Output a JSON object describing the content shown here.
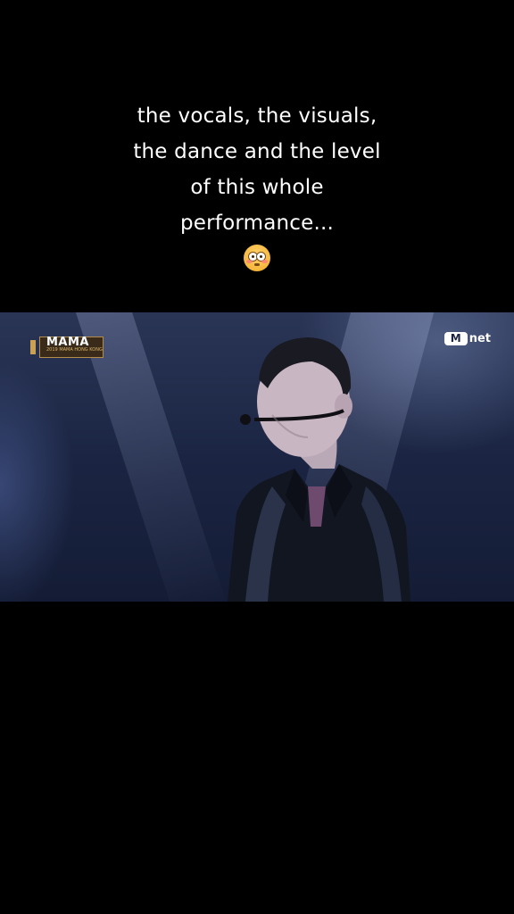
{
  "caption": {
    "lines": [
      "the vocals, the visuals,",
      "the dance and the level",
      "of this whole",
      "performance..."
    ],
    "emoji": "flushed-face-emoji"
  },
  "video": {
    "logo_left": {
      "word": "MAMA",
      "sub": "2019 MAMA HONG KONG"
    },
    "logo_right": {
      "m": "M",
      "net": "net"
    }
  },
  "colors": {
    "background": "#000000",
    "caption_text": "#ffffff",
    "stage_blue": "#1b2543"
  }
}
